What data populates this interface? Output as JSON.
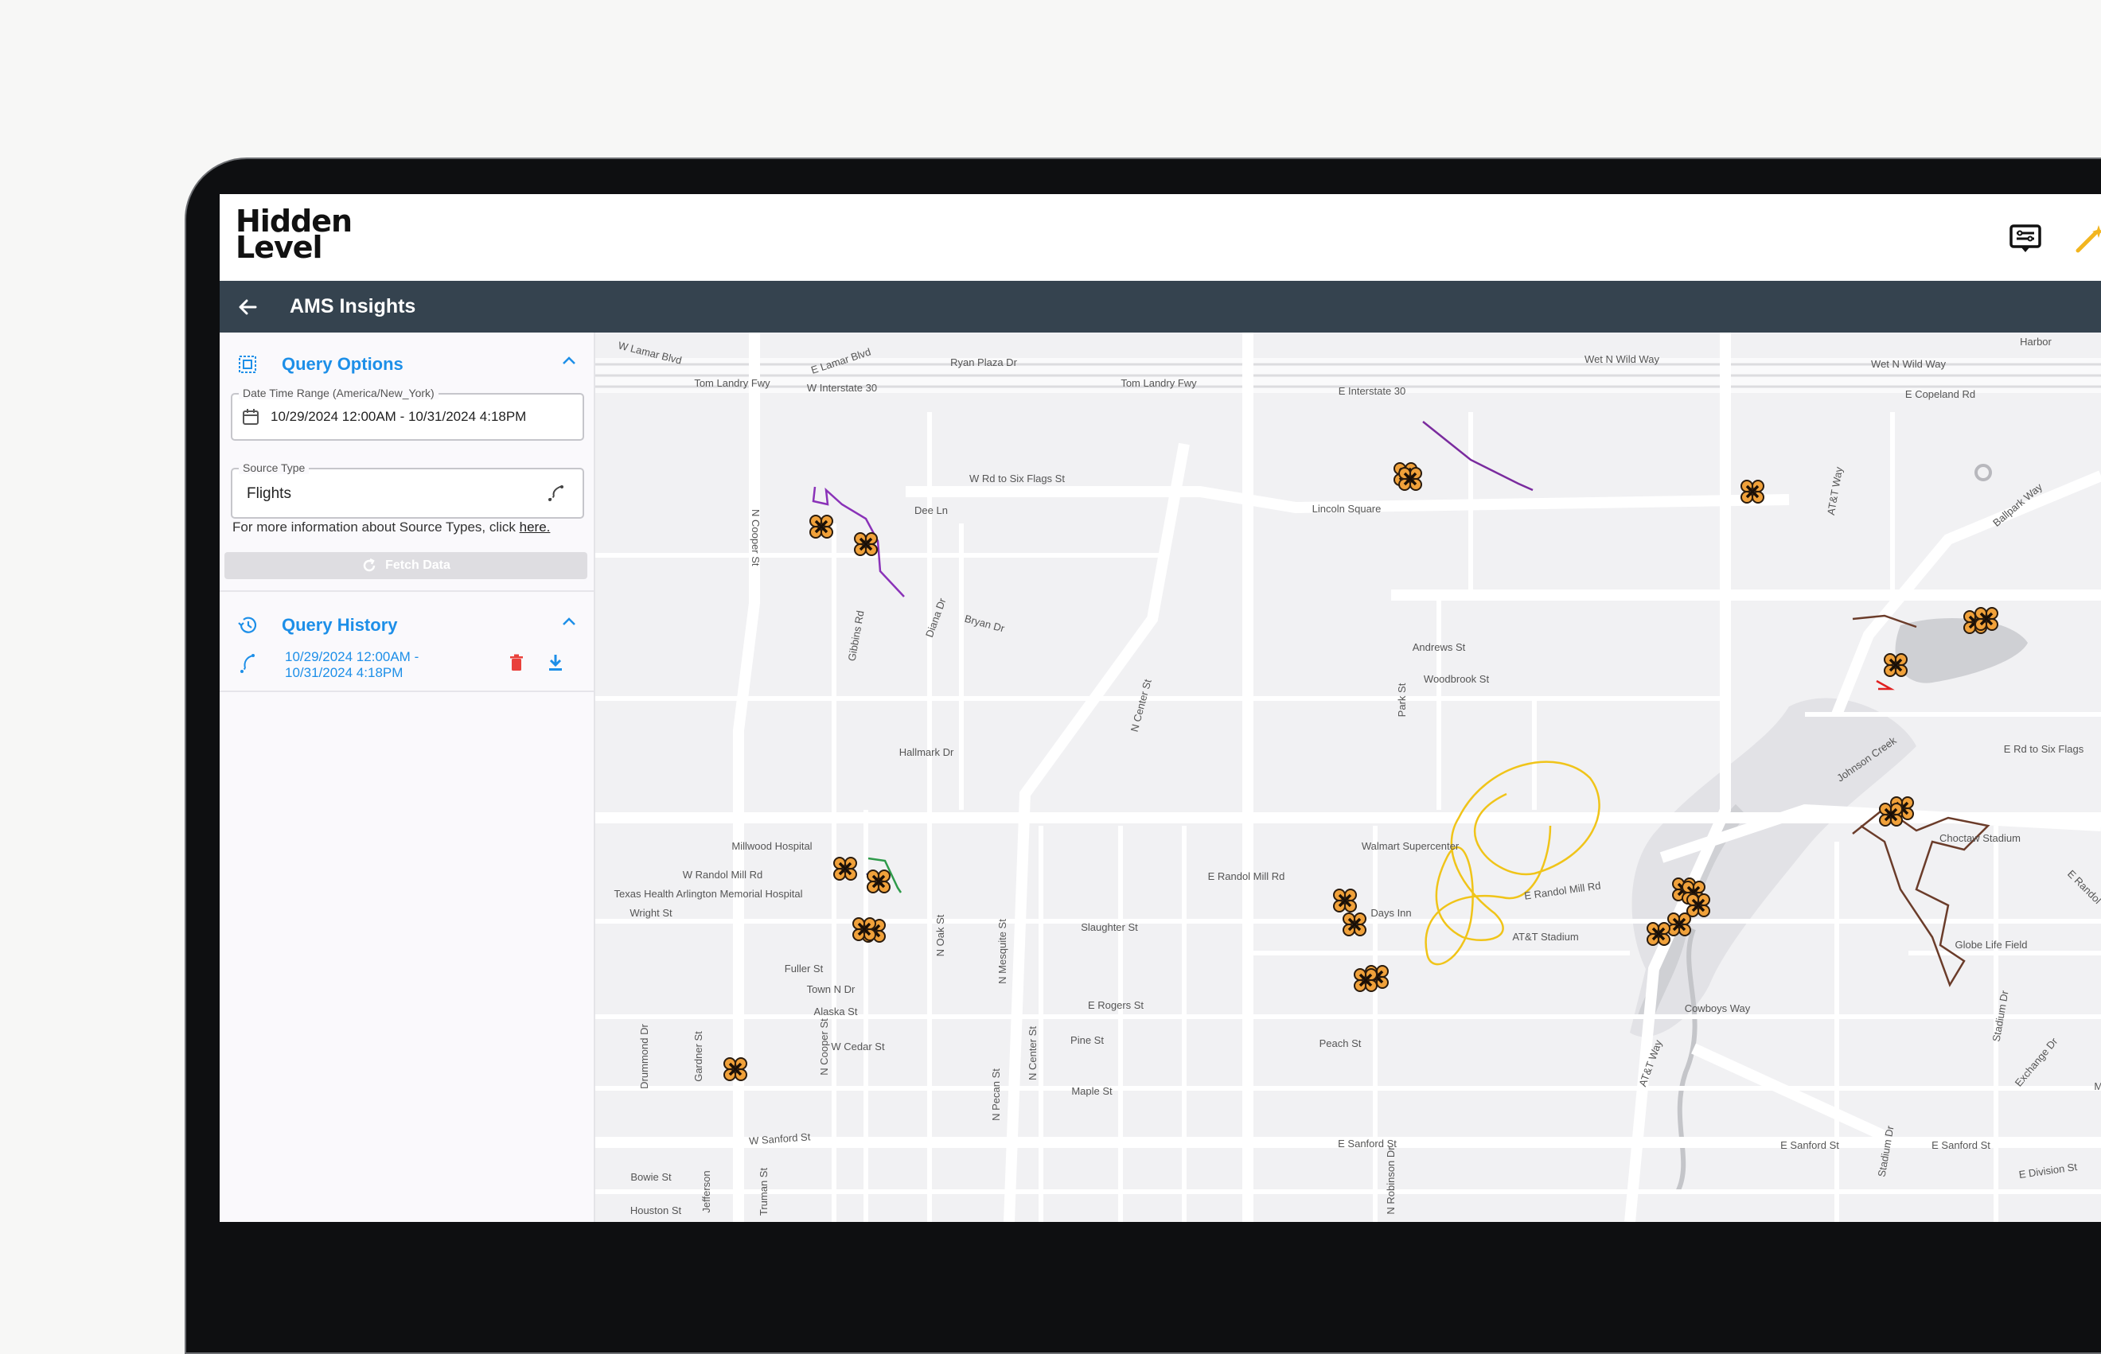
{
  "app": {
    "logo_line1": "Hidden",
    "logo_line2": "Level",
    "title": "AMS Insights"
  },
  "query_options": {
    "title": "Query Options",
    "date_range_label": "Date Time Range (America/New_York)",
    "date_range_value": "10/29/2024 12:00AM - 10/31/2024 4:18PM",
    "source_type_label": "Source Type",
    "source_type_value": "Flights",
    "info_text": "For more information about Source Types, click",
    "info_link": "here.",
    "fetch_button": "Fetch Data"
  },
  "query_history": {
    "title": "Query History",
    "items": [
      {
        "line1": "10/29/2024 12:00AM -",
        "line2": "10/31/2024 4:18PM"
      }
    ]
  },
  "map": {
    "street_labels": [
      "W Lamar Blvd",
      "E Lamar Blvd",
      "Ryan Plaza Dr",
      "Wet N Wild Way",
      "Wet N Wild Way",
      "Harbor",
      "Tom Landry Fwy",
      "W Interstate 30",
      "Tom Landry Fwy",
      "E Interstate 30",
      "E Copeland Rd",
      "W Rd to Six Flags St",
      "Dee Ln",
      "Lincoln Square",
      "N Cooper St",
      "AT&T Way",
      "Ballpark Way",
      "Gibbins Rd",
      "Diana Dr",
      "Bryan Dr",
      "N Center St",
      "Andrews St",
      "Woodbrook St",
      "Park St",
      "Johnson Creek",
      "E Rd to Six Flags",
      "Hallmark Dr",
      "Millwood Hospital",
      "Walmart Supercenter",
      "Choctaw Stadium",
      "W Randol Mill Rd",
      "E Randol Mill Rd",
      "E Randol Mill Rd",
      "E Randol",
      "Texas Health Arlington Memorial Hospital",
      "Wright St",
      "N Oak St",
      "N Mesquite St",
      "Slaughter St",
      "Days Inn",
      "AT&T Stadium",
      "Globe Life Field",
      "Stadium Dr",
      "Fuller St",
      "Town N Dr",
      "Alaska St",
      "N Cooper St",
      "E Rogers St",
      "Cowboys Way",
      "AT&T Way",
      "Drummond Dr",
      "Gardner St",
      "W Cedar St",
      "N Center St",
      "N Pecan St",
      "Pine St",
      "Peach St",
      "Maple St",
      "Exchange Dr",
      "Merl",
      "W Sanford St",
      "E Sanford St",
      "E Sanford St",
      "E Sanford St",
      "Stadium Dr",
      "Bowie St",
      "Jefferson",
      "Houston St",
      "N Robinson Dr",
      "Truman St",
      "E Division St"
    ]
  }
}
